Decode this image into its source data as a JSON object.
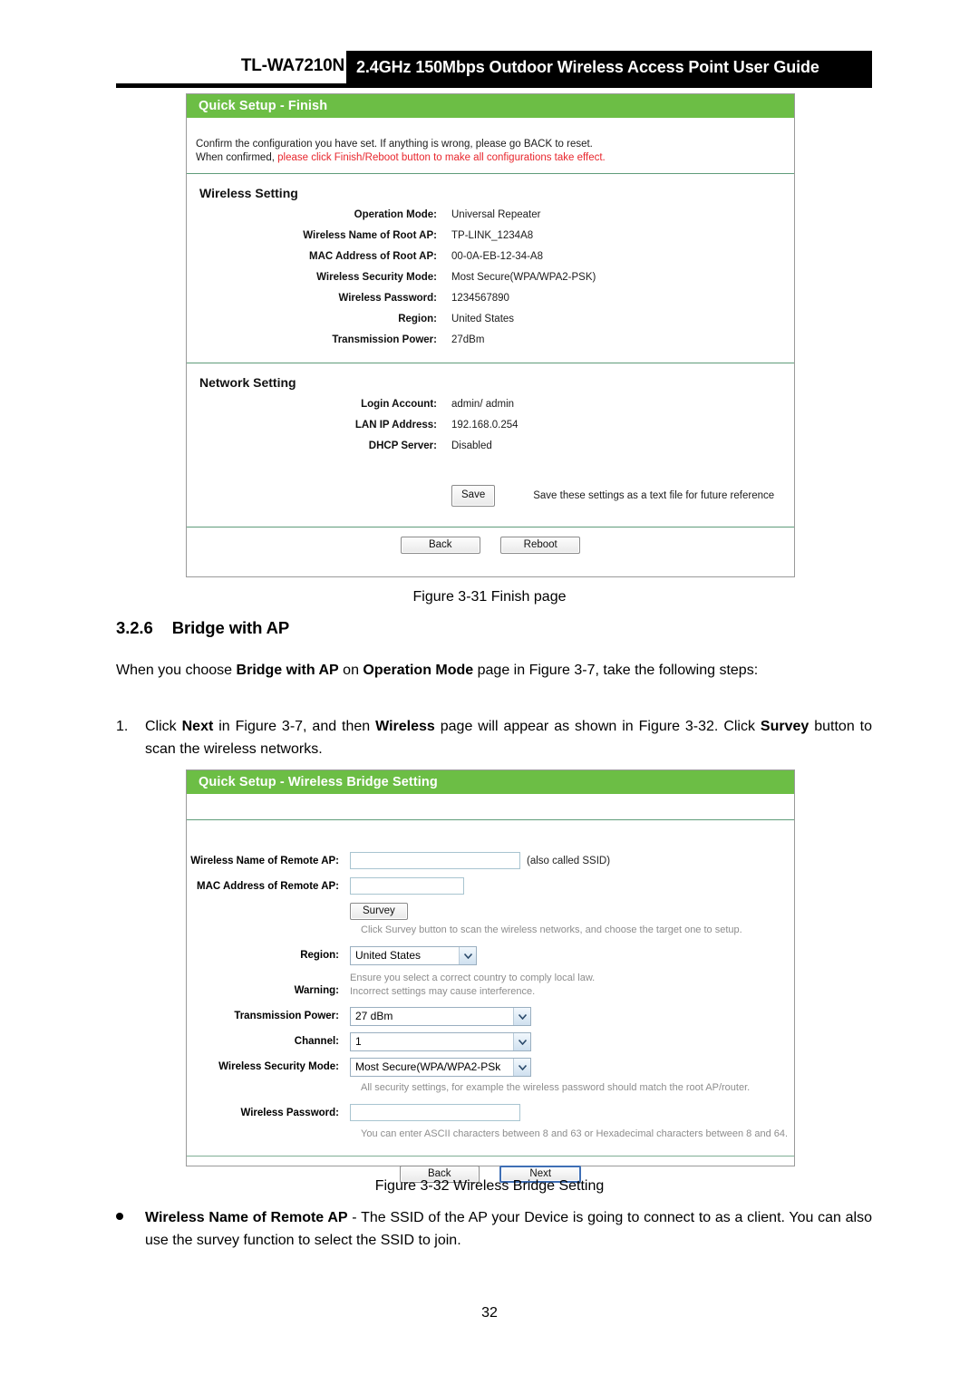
{
  "header": {
    "model": "TL-WA7210N",
    "title": "2.4GHz 150Mbps Outdoor Wireless Access Point User Guide"
  },
  "colors": {
    "panel_green": "#6cbe45",
    "divider_green": "#5f9c7a",
    "warning_red": "#e8262d",
    "note_gray": "#8d8d8d"
  },
  "figure_31": {
    "panel_title": "Quick Setup - Finish",
    "intro_line1": "Confirm the configuration you have set. If anything is wrong, please go BACK to reset.",
    "intro_line2_prefix": "When confirmed, ",
    "intro_line2_red": "please click Finish/Reboot button to make all configurations take effect.",
    "wireless_section": {
      "heading": "Wireless Setting",
      "rows": [
        {
          "label": "Operation Mode:",
          "value": "Universal Repeater"
        },
        {
          "label": "Wireless Name of Root AP:",
          "value": "TP-LINK_1234A8"
        },
        {
          "label": "MAC Address of Root AP:",
          "value": "00-0A-EB-12-34-A8"
        },
        {
          "label": "Wireless Security Mode:",
          "value": "Most Secure(WPA/WPA2-PSK)"
        },
        {
          "label": "Wireless Password:",
          "value": "1234567890"
        },
        {
          "label": "Region:",
          "value": "United States"
        },
        {
          "label": "Transmission Power:",
          "value": "27dBm"
        }
      ]
    },
    "network_section": {
      "heading": "Network Setting",
      "rows": [
        {
          "label": "Login Account:",
          "value": "admin/ admin"
        },
        {
          "label": "LAN IP Address:",
          "value": "192.168.0.254"
        },
        {
          "label": "DHCP Server:",
          "value": "Disabled"
        }
      ],
      "save_button": "Save",
      "save_hint": "Save these settings as a text file for future reference"
    },
    "buttons": {
      "back": "Back",
      "reboot": "Reboot"
    },
    "caption": "Figure 3-31 Finish page"
  },
  "section": {
    "number": "3.2.6",
    "heading": "Bridge with AP",
    "intro": {
      "p1_a": "When you choose ",
      "p1_b": "Bridge with AP",
      "p1_c": " on ",
      "p1_d": "Operation Mode",
      "p1_e": " page in  Figure 3-7, take the following steps:"
    },
    "step1": {
      "num": "1.",
      "a": "Click ",
      "b": "Next",
      "c": " in  Figure 3-7, and then ",
      "d": "Wireless",
      "e": " page will appear as shown in  Figure 3-32. Click ",
      "f": "Survey",
      "g": " button to scan the wireless networks."
    }
  },
  "figure_32": {
    "panel_title": "Quick Setup - Wireless Bridge Setting",
    "fields": {
      "ssid_label": "Wireless Name of Remote AP:",
      "ssid_value": "",
      "ssid_suffix": "(also called SSID)",
      "mac_label": "MAC Address of Remote AP:",
      "mac_value": "",
      "survey_button": "Survey",
      "survey_hint": "Click Survey button to scan the wireless networks, and choose the target one to setup.",
      "region_label": "Region:",
      "region_value": "United States",
      "warning_label": "Warning:",
      "warning_line1": "Ensure you select a correct country to comply local law.",
      "warning_line2": "Incorrect settings may cause interference.",
      "power_label": "Transmission Power:",
      "power_value": "27 dBm",
      "channel_label": "Channel:",
      "channel_value": "1",
      "security_label": "Wireless Security Mode:",
      "security_value": "Most Secure(WPA/WPA2-PSk",
      "security_hint": "All security settings, for example the wireless password should match the root AP/router.",
      "password_label": "Wireless Password:",
      "password_value": "",
      "password_hint": "You can enter ASCII characters between 8 and 63 or Hexadecimal characters between 8 and 64."
    },
    "buttons": {
      "back": "Back",
      "next": "Next"
    },
    "caption": "Figure 3-32 Wireless Bridge Setting"
  },
  "bullet": {
    "term": "Wireless Name of Remote AP",
    "body": " - The SSID of the AP your Device is going to connect to as a client. You can also use the survey function to select the SSID to join."
  },
  "page_number": "32"
}
